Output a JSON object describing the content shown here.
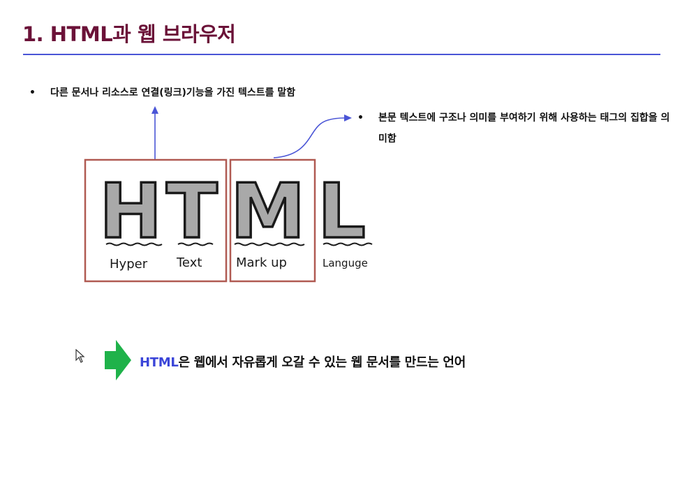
{
  "page_title": "1. HTML과 웹 브라우저",
  "bullets": [
    {
      "symbol": "•",
      "text": "다른 문서나 리소스로 연결(링크)기능을 가진 텍스트를 말함"
    },
    {
      "symbol": "•",
      "text": "본문 텍스트에 구조나 의미를 부여하기 위해 사용하는 태그의 집합을 의미함"
    }
  ],
  "illustration": {
    "letters": [
      "H",
      "T",
      "M",
      "L"
    ],
    "labels": [
      "Hyper",
      "Text",
      "Mark up",
      "Languge"
    ]
  },
  "summary": {
    "highlight": "HTML",
    "rest": "은 웹에서 자유롭게 오갈 수 있는 웹 문서를 만드는 언어"
  },
  "colors": {
    "title": "#6b1238",
    "rule": "#4a55d6",
    "highlight": "#3b45d8",
    "box": "#b05a52",
    "arrow_green": "#1fb24a",
    "letter_fill": "#a9a9a9"
  },
  "icons": {
    "cursor": "mouse-pointer-icon",
    "summary_arrow": "green-right-arrow-icon"
  }
}
